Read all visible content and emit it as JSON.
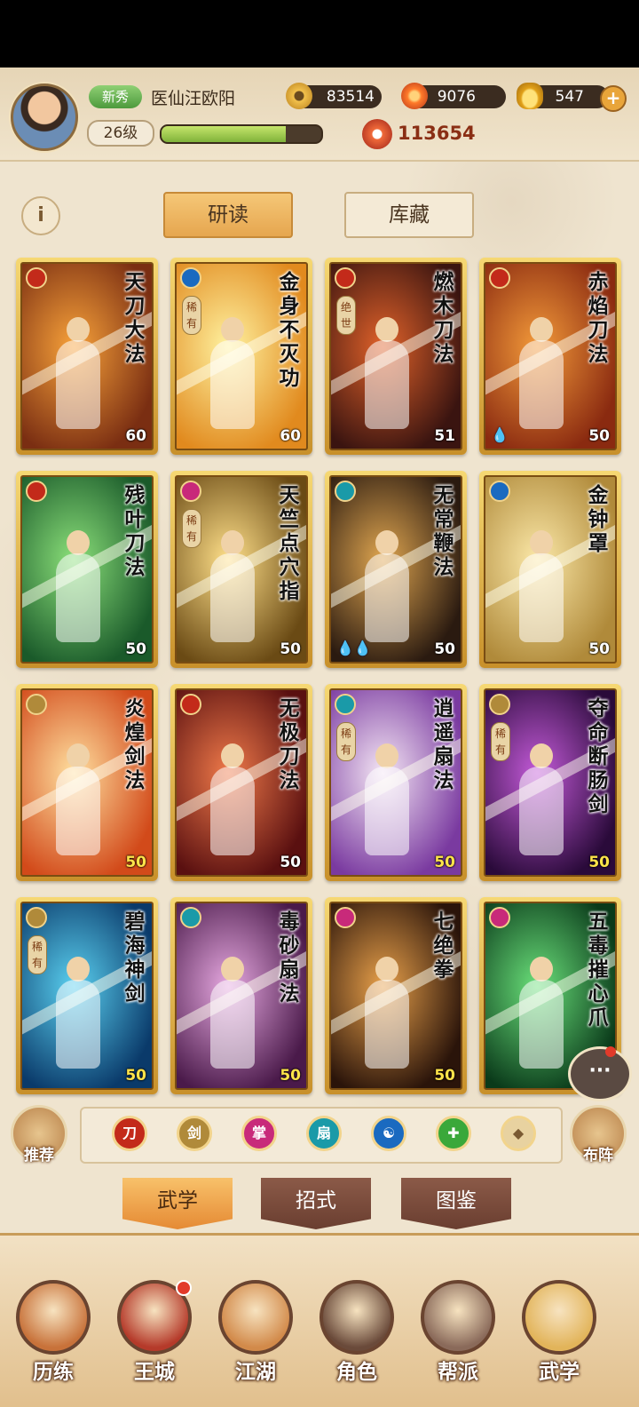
{
  "header": {
    "rank": "新秀",
    "player_name": "医仙汪欧阳",
    "level": "26级",
    "xp_fraction": 0.78,
    "coins": "83514",
    "flames": "9076",
    "ingots": "547",
    "power": "113654"
  },
  "tabs_top": {
    "study": "研读",
    "collection": "库藏"
  },
  "cards": [
    {
      "name": "天刀大法",
      "level": "60",
      "type": "blade",
      "rare": "",
      "bg": [
        "#f8a23a",
        "#7a2e12"
      ],
      "gold": false,
      "drops": ""
    },
    {
      "name": "金身不灭功",
      "level": "60",
      "type": "taiji",
      "rare": "稀有",
      "bg": [
        "#fff2a0",
        "#e18a1e"
      ],
      "gold": false,
      "drops": ""
    },
    {
      "name": "燃木刀法",
      "level": "51",
      "type": "blade",
      "rare": "绝世",
      "bg": [
        "#e1622a",
        "#3a1410"
      ],
      "gold": false,
      "drops": ""
    },
    {
      "name": "赤焰刀法",
      "level": "50",
      "type": "blade",
      "rare": "",
      "bg": [
        "#f39a3a",
        "#8a2a10"
      ],
      "gold": false,
      "drops": "💧"
    },
    {
      "name": "残叶刀法",
      "level": "50",
      "type": "blade",
      "rare": "",
      "bg": [
        "#8be07a",
        "#1a5a2a"
      ],
      "gold": false,
      "drops": ""
    },
    {
      "name": "天竺点穴指",
      "level": "50",
      "type": "palm",
      "rare": "稀有",
      "bg": [
        "#ffe08a",
        "#6a4a14"
      ],
      "gold": false,
      "drops": ""
    },
    {
      "name": "无常鞭法",
      "level": "50",
      "type": "fan",
      "rare": "",
      "bg": [
        "#e0a650",
        "#2a1a10"
      ],
      "gold": false,
      "drops": "💧💧"
    },
    {
      "name": "金钟罩",
      "level": "50",
      "type": "taiji",
      "rare": "",
      "bg": [
        "#fbe8a8",
        "#b08a3a"
      ],
      "gold": false,
      "drops": ""
    },
    {
      "name": "炎煌剑法",
      "level": "50",
      "type": "sword",
      "rare": "",
      "bg": [
        "#ffe0a0",
        "#d24a1a"
      ],
      "gold": true,
      "drops": ""
    },
    {
      "name": "无极刀法",
      "level": "50",
      "type": "blade",
      "rare": "",
      "bg": [
        "#f07a4a",
        "#5a1010"
      ],
      "gold": false,
      "drops": ""
    },
    {
      "name": "逍遥扇法",
      "level": "50",
      "type": "fan",
      "rare": "稀有",
      "bg": [
        "#f4e6f4",
        "#7a3aa0"
      ],
      "gold": true,
      "drops": ""
    },
    {
      "name": "夺命断肠剑",
      "level": "50",
      "type": "sword",
      "rare": "稀有",
      "bg": [
        "#c35ad8",
        "#2a0a3a"
      ],
      "gold": true,
      "drops": ""
    },
    {
      "name": "碧海神剑",
      "level": "50",
      "type": "sword",
      "rare": "稀有",
      "bg": [
        "#5ad0f0",
        "#0a3a6a"
      ],
      "gold": true,
      "drops": ""
    },
    {
      "name": "毒砂扇法",
      "level": "50",
      "type": "fan",
      "rare": "",
      "bg": [
        "#e6a8e0",
        "#4a1a4a"
      ],
      "gold": true,
      "drops": ""
    },
    {
      "name": "七绝拳",
      "level": "50",
      "type": "palm",
      "rare": "",
      "bg": [
        "#e8a04a",
        "#2a140a"
      ],
      "gold": true,
      "drops": ""
    },
    {
      "name": "五毒摧心爪",
      "level": "",
      "type": "palm",
      "rare": "",
      "bg": [
        "#6ae07a",
        "#0a3a1a"
      ],
      "gold": false,
      "drops": ""
    }
  ],
  "filter": {
    "recommend": "推荐",
    "formation": "布阵",
    "icons": [
      {
        "name": "blade-filter-icon",
        "color": "#c32a1a",
        "glyph": "刀"
      },
      {
        "name": "sword-filter-icon",
        "color": "#b08a3a",
        "glyph": "剑"
      },
      {
        "name": "palm-filter-icon",
        "color": "#c82a7a",
        "glyph": "掌"
      },
      {
        "name": "fan-filter-icon",
        "color": "#1a9aa8",
        "glyph": "扇"
      },
      {
        "name": "taiji-filter-icon",
        "color": "#1a6ac0",
        "glyph": "☯"
      },
      {
        "name": "heal-filter-icon",
        "color": "#3aa83a",
        "glyph": "✚"
      },
      {
        "name": "other-filter-icon",
        "color": "#e8d2a0",
        "glyph": "◆"
      }
    ]
  },
  "bottom_tabs": {
    "martial": "武学",
    "moves": "招式",
    "codex": "图鉴"
  },
  "nav": [
    {
      "label": "历练",
      "color": "#c8723a",
      "dot": false
    },
    {
      "label": "王城",
      "color": "#b53a2a",
      "dot": true
    },
    {
      "label": "江湖",
      "color": "#d28a4a",
      "dot": false
    },
    {
      "label": "角色",
      "color": "#6a4a3a",
      "dot": false
    },
    {
      "label": "帮派",
      "color": "#8a6a5a",
      "dot": false
    },
    {
      "label": "武学",
      "color": "#e2b45a",
      "dot": false
    }
  ],
  "chat": "···"
}
